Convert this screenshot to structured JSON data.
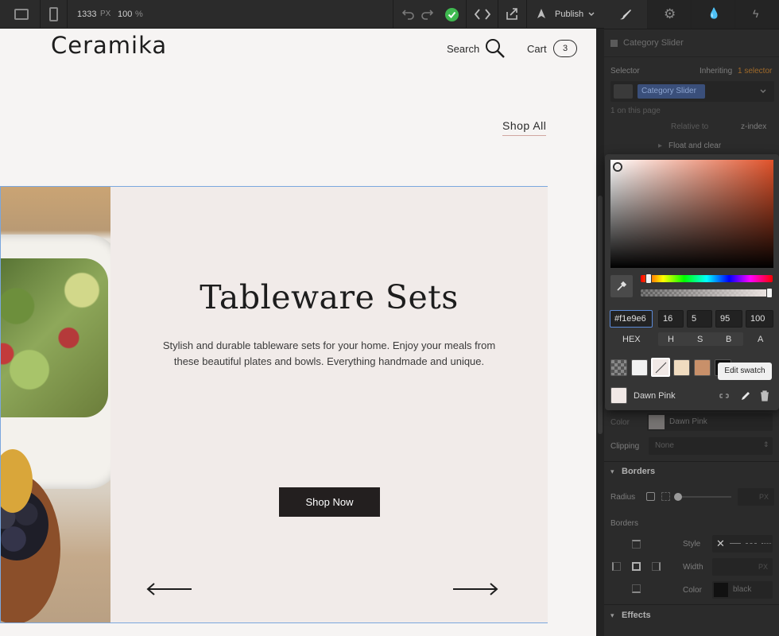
{
  "topbar": {
    "width_value": "1333",
    "width_unit": "PX",
    "zoom_value": "100",
    "zoom_unit": "%",
    "publish_label": "Publish"
  },
  "site": {
    "logo": "Ceramika",
    "search_label": "Search",
    "cart_label": "Cart",
    "cart_count": "3",
    "shop_all": "Shop All",
    "hero_title": "Tableware Sets",
    "hero_text": "Stylish and durable tableware sets for your home. Enjoy your meals from these beautiful plates and bowls. Everything handmade and unique.",
    "shop_now": "Shop Now"
  },
  "panel": {
    "header_title": "Category Slider",
    "selector_label": "Selector",
    "inheriting_label": "Inheriting",
    "inheriting_count": "1 selector",
    "selector_chip": "Category Slider",
    "on_page": "1 on this page",
    "relative_to": "Relative to",
    "z_index": "z-index",
    "float_clear": "Float and clear",
    "color_label": "Color",
    "color_value": "Dawn Pink",
    "clipping_label": "Clipping",
    "clipping_value": "None",
    "borders_section": "Borders",
    "radius_label": "Radius",
    "radius_unit": "PX",
    "borders_label": "Borders",
    "style_label": "Style",
    "width_label": "Width",
    "width_unit": "PX",
    "border_color_label": "Color",
    "border_color_value": "black",
    "effects_section": "Effects"
  },
  "picker": {
    "hex_value": "#f1e9e6",
    "h_value": "16",
    "s_value": "5",
    "b_value": "95",
    "a_value": "100",
    "hex_label": "HEX",
    "h_label": "H",
    "s_label": "S",
    "b_label": "B",
    "a_label": "A",
    "swatch_name": "Dawn Pink",
    "tooltip": "Edit swatch",
    "swatch_colors": [
      "#f2f2f2",
      "#f1e9e6",
      "#f0dcc0",
      "#c8906a",
      "#111111"
    ]
  }
}
